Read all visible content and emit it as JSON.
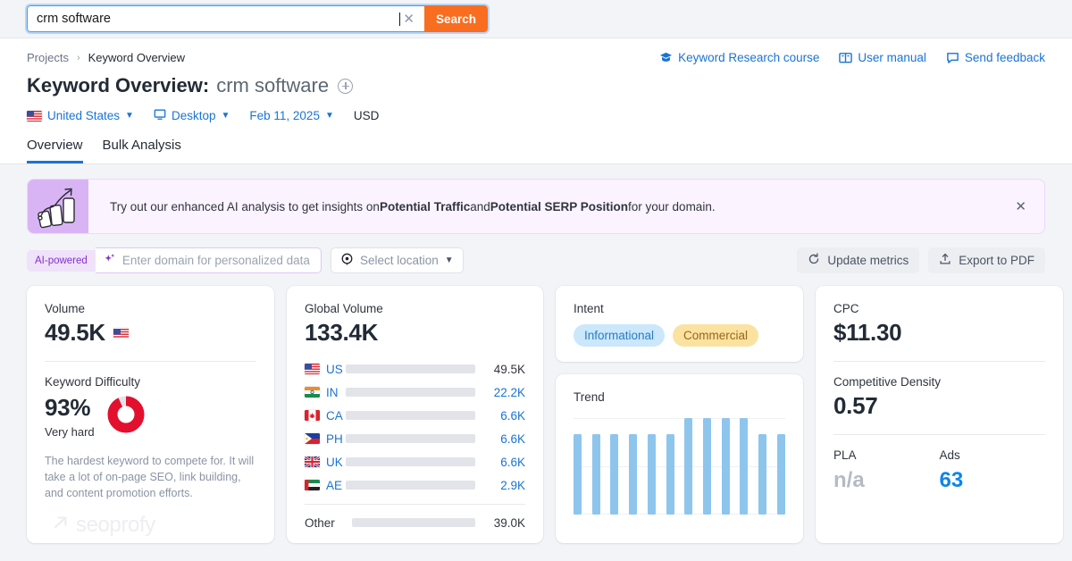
{
  "search": {
    "value": "crm software",
    "button_label": "Search",
    "clear_icon": "close-icon"
  },
  "header": {
    "breadcrumb": {
      "parent": "Projects",
      "separator": "›",
      "current": "Keyword Overview"
    },
    "title_prefix": "Keyword Overview:",
    "title_keyword": "crm software",
    "links": [
      {
        "label": "Keyword Research course",
        "icon": "graduation-cap-icon"
      },
      {
        "label": "User manual",
        "icon": "book-icon"
      },
      {
        "label": "Send feedback",
        "icon": "chat-bubble-icon"
      }
    ],
    "filters": {
      "country": "United States",
      "device": "Desktop",
      "date": "Feb 11, 2025",
      "currency": "USD"
    },
    "tabs": [
      {
        "label": "Overview",
        "active": true
      },
      {
        "label": "Bulk Analysis",
        "active": false
      }
    ]
  },
  "banner": {
    "text_before": "Try out our enhanced AI analysis to get insights on ",
    "bold_1": "Potential Traffic",
    "text_mid": " and ",
    "bold_2": "Potential SERP Position",
    "text_after": " for your domain.",
    "close_icon": "close-icon",
    "icon": "growth-chart-icon"
  },
  "toolbar": {
    "ai_badge": "AI-powered",
    "domain_placeholder": "Enter domain for personalized data",
    "location_label": "Select location",
    "update_metrics": "Update metrics",
    "export_pdf": "Export to PDF"
  },
  "cards": {
    "volume": {
      "label": "Volume",
      "value": "49.5K",
      "flag": "us"
    },
    "keyword_difficulty": {
      "label": "Keyword Difficulty",
      "value": "93%",
      "word": "Very hard",
      "description": "The hardest keyword to compete for. It will take a lot of on-page SEO, link building, and content promotion efforts.",
      "percent": 93,
      "color": "#e2102e"
    },
    "global_volume": {
      "label": "Global Volume",
      "value": "133.4K",
      "rows": [
        {
          "code": "US",
          "flag": "us",
          "value": "49.5K",
          "pct": 100,
          "color": "#0b6fd4",
          "highlight": true
        },
        {
          "code": "IN",
          "flag": "in",
          "value": "22.2K",
          "pct": 45,
          "color": "#37b0fb",
          "highlight": false
        },
        {
          "code": "CA",
          "flag": "ca",
          "value": "6.6K",
          "pct": 6,
          "color": "#37b0fb",
          "highlight": false
        },
        {
          "code": "PH",
          "flag": "ph",
          "value": "6.6K",
          "pct": 6,
          "color": "#37b0fb",
          "highlight": false
        },
        {
          "code": "UK",
          "flag": "uk",
          "value": "6.6K",
          "pct": 6,
          "color": "#37b0fb",
          "highlight": false
        },
        {
          "code": "AE",
          "flag": "ae",
          "value": "2.9K",
          "pct": 3,
          "color": "#37b0fb",
          "highlight": false
        }
      ],
      "other": {
        "label": "Other",
        "value": "39.0K",
        "pct": 34,
        "color": "#37b0fb"
      }
    },
    "intent": {
      "label": "Intent",
      "pills": [
        {
          "label": "Informational",
          "style": "info"
        },
        {
          "label": "Commercial",
          "style": "comm"
        }
      ]
    },
    "trend": {
      "label": "Trend"
    },
    "cpc": {
      "label": "CPC",
      "value": "$11.30"
    },
    "competitive_density": {
      "label": "Competitive Density",
      "value": "0.57"
    },
    "pla": {
      "label": "PLA",
      "value": "n/a"
    },
    "ads": {
      "label": "Ads",
      "value": "63"
    }
  },
  "watermark": {
    "text": "seoprofy",
    "icon": "arrow-up-right-icon"
  },
  "chart_data": {
    "type": "bar",
    "title": "Trend",
    "categories": [
      "1",
      "2",
      "3",
      "4",
      "5",
      "6",
      "7",
      "8",
      "9",
      "10",
      "11",
      "12"
    ],
    "values": [
      83,
      83,
      83,
      83,
      83,
      83,
      100,
      100,
      100,
      100,
      83,
      83
    ],
    "xlabel": "",
    "ylabel": "",
    "ylim": [
      0,
      100
    ],
    "grid": true,
    "legend": "none",
    "color": "#8ec5ed"
  }
}
